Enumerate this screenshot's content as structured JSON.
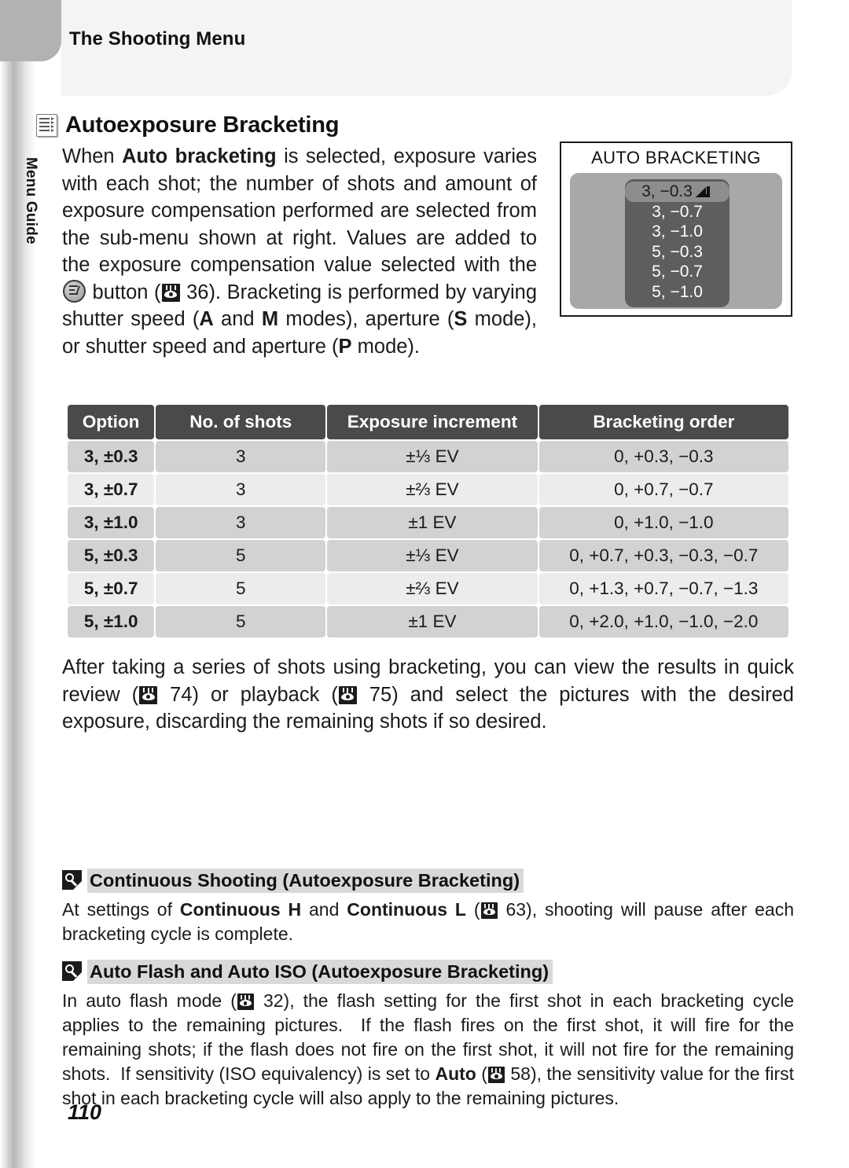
{
  "page": {
    "running_header": "The Shooting Menu",
    "side_tab_label": "Menu Guide",
    "page_number": "110",
    "section_icon": "menu-list-icon"
  },
  "section": {
    "title": "Autoexposure Bracketing",
    "intro_html": "When <b>Auto bracketing</b> is selected, exposure varies with each shot; the number of shots and amount of exposure compensation performed are selected from the sub-menu shown at right. Values are added to the exposure compensation value selected with the [EV] button ([REF] 36). Bracketing is performed by varying shutter speed (<b>A</b> and <b>M</b> modes), aperture (<b>S</b> mode), or shutter speed and aperture (<b>P</b> mode).",
    "intro_ref_page": "36",
    "after_table_html": "After taking a series of shots using bracketing, you can view the results in quick review ([REF] 74) or playback ([REF] 75) and select the pictures with the desired exposure, discarding the remaining shots if so desired.",
    "after_table_refs": [
      "74",
      "75"
    ]
  },
  "lcd": {
    "title": "AUTO BRACKETING",
    "items": [
      {
        "label": "3, −0.3",
        "selected": true,
        "enter_icon": "enter-arrow-icon"
      },
      {
        "label": "3, −0.7",
        "selected": false
      },
      {
        "label": "3, −1.0",
        "selected": false
      },
      {
        "label": "5, −0.3",
        "selected": false
      },
      {
        "label": "5, −0.7",
        "selected": false
      },
      {
        "label": "5, −1.0",
        "selected": false
      }
    ]
  },
  "table": {
    "headers": [
      "Option",
      "No. of shots",
      "Exposure increment",
      "Bracketing order"
    ],
    "rows": [
      {
        "option": "3, ±0.3",
        "shots": "3",
        "increment": "±⅓ EV",
        "order": "0, +0.3, −0.3"
      },
      {
        "option": "3, ±0.7",
        "shots": "3",
        "increment": "±⅔ EV",
        "order": "0, +0.7, −0.7"
      },
      {
        "option": "3, ±1.0",
        "shots": "3",
        "increment": "±1 EV",
        "order": "0, +1.0, −1.0"
      },
      {
        "option": "5, ±0.3",
        "shots": "5",
        "increment": "±⅓ EV",
        "order": "0, +0.7, +0.3, −0.3, −0.7"
      },
      {
        "option": "5, ±0.7",
        "shots": "5",
        "increment": "±⅔ EV",
        "order": "0, +1.3, +0.7, −0.7, −1.3"
      },
      {
        "option": "5, ±1.0",
        "shots": "5",
        "increment": "±1 EV",
        "order": "0, +2.0, +1.0, −1.0, −2.0"
      }
    ]
  },
  "notes": [
    {
      "icon": "magnifier-note-icon",
      "title": "Continuous Shooting (Autoexposure Bracketing)",
      "body_html": "At settings of <b>Continuous H</b> and <b>Continuous L</b> ([REF] 63), shooting will pause after each bracketing cycle is complete.",
      "refs": [
        "63"
      ]
    },
    {
      "icon": "magnifier-note-icon",
      "title": "Auto Flash and Auto ISO (Autoexposure Bracketing)",
      "body_html": "In auto flash mode ([REF] 32), the flash setting for the first shot in each bracketing cycle applies to the remaining pictures.  If the flash fires on the first shot, it will fire for the remaining shots; if the flash does not fire on the first shot, it will not fire for the remaining shots.  If sensitivity (ISO equivalency) is set to <b>Auto</b> ([REF] 58), the sensitivity value for the first shot in each bracketing cycle will also apply to the remaining pictures.",
      "refs": [
        "32",
        "58"
      ]
    }
  ],
  "colors": {
    "header_panel": "#f4f4f2",
    "chapter_tab": "#b2b2b2",
    "table_header": "#4a4a4a",
    "row_odd": "#d2d2d2",
    "row_even": "#ececec",
    "lcd_panel": "#a8a8a8",
    "lcd_list": "#5e5e5e",
    "lcd_selected": "#8d8d8d",
    "note_title_highlight": "#d9d9d9"
  }
}
